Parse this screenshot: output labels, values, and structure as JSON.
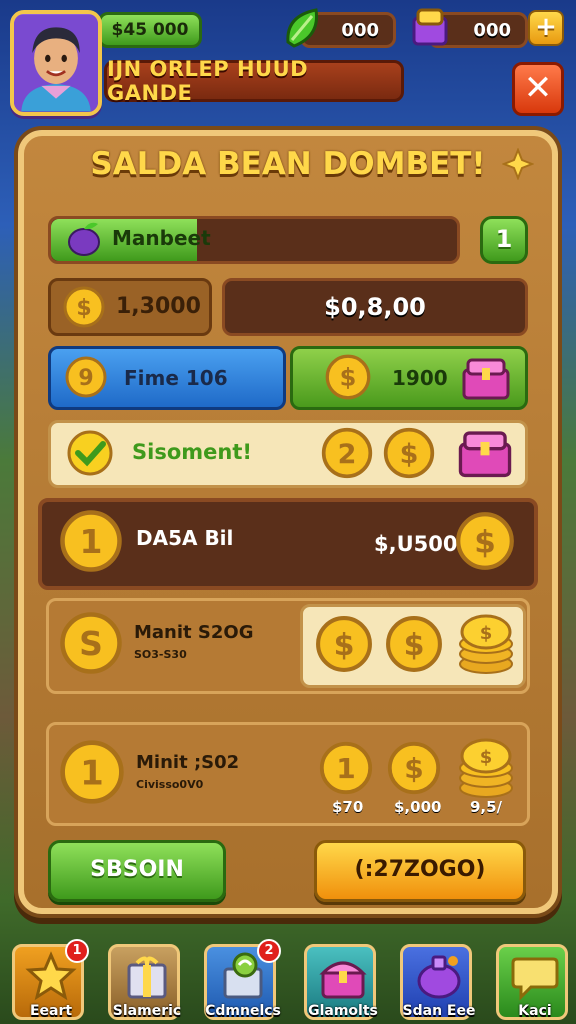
{
  "header": {
    "gold_value": "$45 000",
    "gems_value": "000",
    "chests_value": "000",
    "plus_label": "+",
    "title": "IJN ORLEP HUUD GANDE",
    "close_label": "✕"
  },
  "panel": {
    "title": "SALDA BEAN DOMBET!",
    "progress": {
      "label": "Manbeet",
      "fill_fraction": 0.36,
      "level": "1"
    },
    "row1": {
      "coin_amount": "1,3000",
      "balance": "$0,8,00"
    },
    "row2": {
      "blue_coin": "9",
      "blue_label": "Fime 106",
      "green_coin": "$",
      "green_value": "1900"
    },
    "row3": {
      "label": "Sisoment!",
      "coin_a": "2",
      "coin_b": "$"
    },
    "row4": {
      "coin": "1",
      "label": "DA5A Bil",
      "value": "$,U500",
      "coin_right": "$"
    },
    "row5": {
      "coin": "S",
      "title": "Manit S2OG",
      "sub": "SO3-S30",
      "c1": "$",
      "c2": "$",
      "c3": "$"
    },
    "row6": {
      "coin": "1",
      "title": "Minit ;S02",
      "sub": "Civisso0V0",
      "c1": "1",
      "c2": "$",
      "c3": "$",
      "p1": "$70",
      "p2": "$,000",
      "p3": "9,5/"
    },
    "btn_left": "SBSOIN",
    "btn_right": "(:27ZOGO)"
  },
  "nav": [
    {
      "label": "Eeart",
      "badge": "1",
      "icon": "star-icon"
    },
    {
      "label": "Slameric",
      "badge": "",
      "icon": "gift-box-icon"
    },
    {
      "label": "Cdmnelcs",
      "badge": "2",
      "icon": "candy-icon"
    },
    {
      "label": "Glamolts",
      "badge": "",
      "icon": "chest-icon"
    },
    {
      "label": "Sdan Eee",
      "badge": "",
      "icon": "potion-icon"
    },
    {
      "label": "Kaci",
      "badge": "",
      "icon": "chat-icon"
    }
  ],
  "colors": {
    "panel": "#b57a34",
    "accent_gold": "#ffd84a",
    "green": "#3f9a1c",
    "blue": "#1f6ac8"
  }
}
